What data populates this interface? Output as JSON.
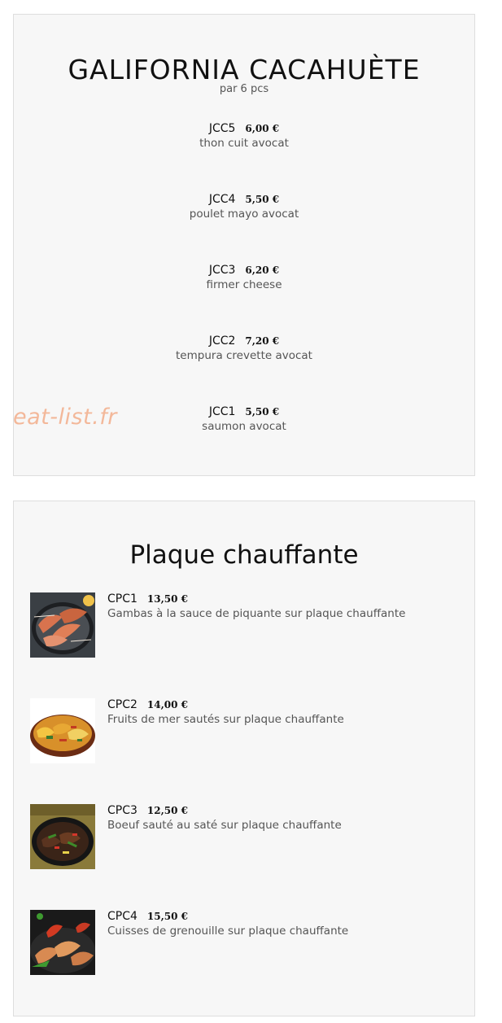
{
  "california": {
    "title": "GALIFORNIA CACAHUÈTE",
    "subtitle": "par 6 pcs",
    "items": [
      {
        "code": "JCC5",
        "price": "6,00 €",
        "desc": "thon cuit avocat"
      },
      {
        "code": "JCC4",
        "price": "5,50 €",
        "desc": "poulet mayo avocat"
      },
      {
        "code": "JCC3",
        "price": "6,20 €",
        "desc": "firmer cheese"
      },
      {
        "code": "JCC2",
        "price": "7,20 €",
        "desc": "tempura crevette avocat"
      },
      {
        "code": "JCC1",
        "price": "5,50 €",
        "desc": "saumon avocat"
      }
    ]
  },
  "watermark": "eat-list.fr",
  "plaque": {
    "title": "Plaque chauffante",
    "items": [
      {
        "code": "CPC1",
        "price": "13,50 €",
        "desc": "Gambas à la sauce de piquante sur plaque chauffante",
        "photo": "grilled-shrimp-photo"
      },
      {
        "code": "CPC2",
        "price": "14,00 €",
        "desc": "Fruits de mer sautés sur plaque chauffante",
        "photo": "sauteed-seafood-photo"
      },
      {
        "code": "CPC3",
        "price": "12,50 €",
        "desc": "Boeuf sauté au saté sur plaque chauffante",
        "photo": "beef-sate-photo"
      },
      {
        "code": "CPC4",
        "price": "15,50 €",
        "desc": "Cuisses de grenouille sur plaque chauffante",
        "photo": "frog-legs-photo"
      }
    ]
  },
  "colors": {
    "card_background": "#f7f7f7",
    "card_border": "#dedede",
    "watermark": "#f3b89a",
    "title_text": "#111111",
    "description_text": "#555555"
  }
}
